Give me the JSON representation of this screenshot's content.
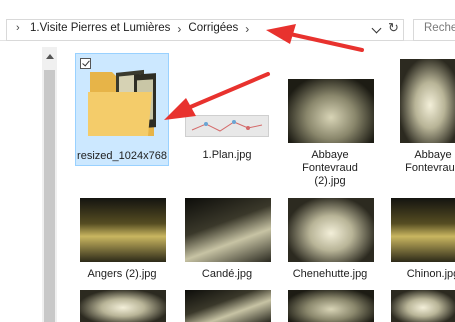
{
  "address_bar": {
    "breadcrumbs": [
      "1.Visite Pierres et Lumières",
      "Corrigées"
    ],
    "search_placeholder": "Rechercher"
  },
  "files": [
    {
      "name": "resized_1024x768",
      "type": "folder",
      "selected": true
    },
    {
      "name": "1.Plan.jpg",
      "type": "image"
    },
    {
      "name": "Abbaye Fontevraud (2).jpg",
      "type": "image"
    },
    {
      "name": "Abbaye Fontevraud",
      "type": "image"
    },
    {
      "name": "Angers (2).jpg",
      "type": "image"
    },
    {
      "name": "Candé.jpg",
      "type": "image"
    },
    {
      "name": "Chenehutte.jpg",
      "type": "image"
    },
    {
      "name": "Chinon.jpg",
      "type": "image"
    }
  ],
  "colors": {
    "selection_fill": "#cce8ff",
    "selection_border": "#99d1ff",
    "annotation_arrow": "#e8322e",
    "folder_yellow": "#f4cc6a"
  }
}
